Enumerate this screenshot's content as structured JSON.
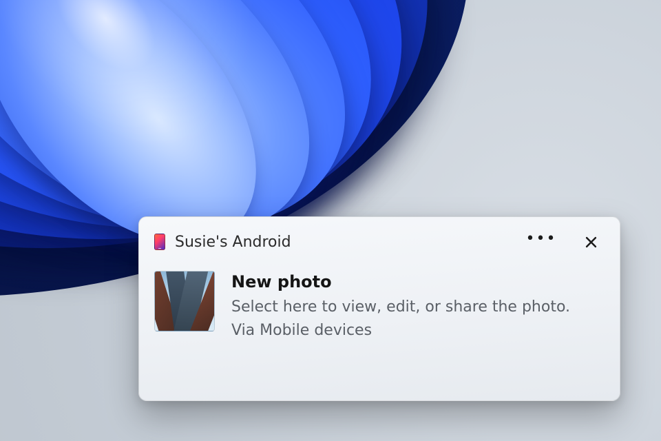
{
  "notification": {
    "device_name": "Susie's Android",
    "device_icon": "phone-icon",
    "more_icon": "more-icon",
    "close_icon": "close-icon",
    "thumbnail_semantic": "new-photo-thumbnail",
    "title": "New photo",
    "description": "Select here to view, edit, or share the photo.",
    "via_line": "Via Mobile devices"
  }
}
